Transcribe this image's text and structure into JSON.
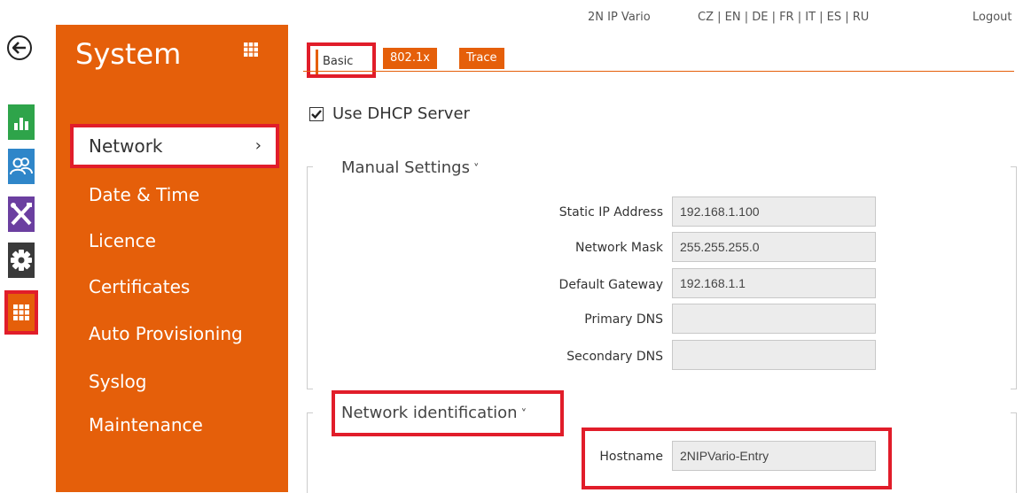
{
  "header": {
    "device_name": "2N IP Vario",
    "languages": "CZ | EN | DE | FR | IT | ES | RU",
    "logout": "Logout"
  },
  "sidebar": {
    "title": "System",
    "items": [
      {
        "label": "Network",
        "chevron": "›"
      },
      {
        "label": "Date & Time"
      },
      {
        "label": "Licence"
      },
      {
        "label": "Certificates"
      },
      {
        "label": "Auto Provisioning"
      },
      {
        "label": "Syslog"
      },
      {
        "label": "Maintenance"
      }
    ]
  },
  "tabs": {
    "basic": "Basic",
    "dot1x": "802.1x",
    "trace": "Trace"
  },
  "dhcp": {
    "label": "Use DHCP Server",
    "checked": true
  },
  "manual_settings": {
    "title": "Manual Settings",
    "chevron": "˅",
    "fields": {
      "static_ip": {
        "label": "Static IP Address",
        "value": "192.168.1.100"
      },
      "mask": {
        "label": "Network Mask",
        "value": "255.255.255.0"
      },
      "gateway": {
        "label": "Default Gateway",
        "value": "192.168.1.1"
      },
      "primary_dns": {
        "label": "Primary DNS",
        "value": ""
      },
      "secondary_dns": {
        "label": "Secondary DNS",
        "value": ""
      }
    }
  },
  "network_identification": {
    "title": "Network identification",
    "chevron": "˅",
    "hostname_label": "Hostname",
    "hostname_value": "2NIPVario-Entry"
  },
  "colors": {
    "accent": "#e55f0a",
    "highlight": "#e11d2a"
  },
  "icons": [
    "back-arrow-icon",
    "status-chart-icon",
    "users-icon",
    "tools-icon",
    "gear-icon",
    "grid-icon"
  ]
}
